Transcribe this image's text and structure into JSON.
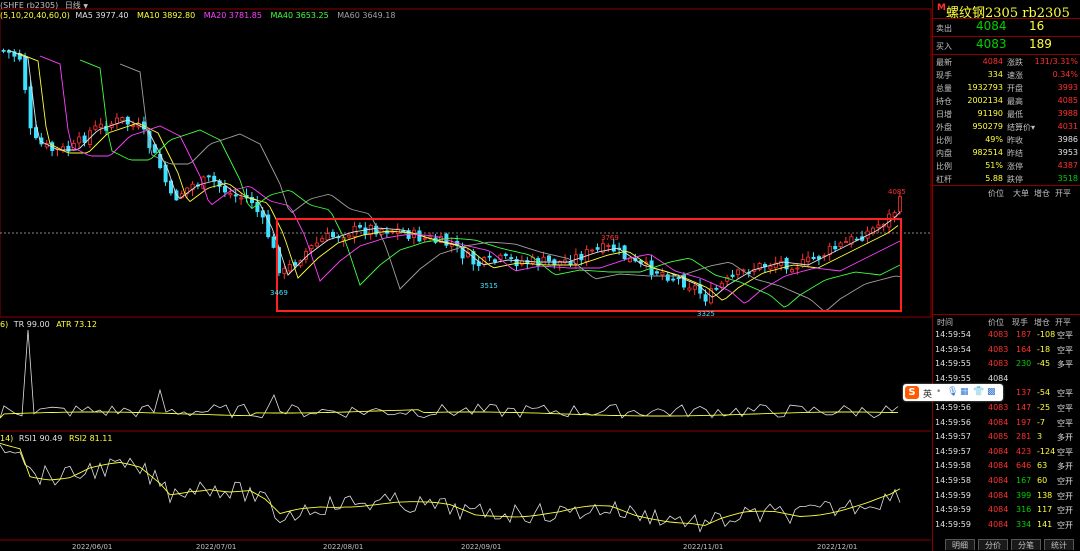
{
  "toolbar": {
    "symbol": "(SHFE rb2305)",
    "period": "日线"
  },
  "ma_legend": {
    "prefix": "(5,10,20,40,60,0)",
    "items": [
      {
        "label": "MA5 3977.40",
        "color": "#e0e0e0"
      },
      {
        "label": "MA10 3892.80",
        "color": "#ffff3a"
      },
      {
        "label": "MA20 3781.85",
        "color": "#ff40ff"
      },
      {
        "label": "MA40 3653.25",
        "color": "#40ff40"
      },
      {
        "label": "MA60 3649.18",
        "color": "#a0a0a0"
      }
    ]
  },
  "atr_legend": {
    "prefix": "6)",
    "tr": "TR 99.00",
    "atr": "ATR 73.12"
  },
  "rsi_legend": {
    "prefix": "14)",
    "rsi1": "RSI1 90.49",
    "rsi2": "RSI2 81.11"
  },
  "annotations": {
    "high_marker": "4085",
    "low_1": "3469",
    "low_2": "3515",
    "high_mid": "3769",
    "low_3": "3325"
  },
  "dates": [
    "2022/06/01",
    "2022/07/01",
    "2022/08/01",
    "2022/09/01",
    "2022/11/01",
    "2022/12/01"
  ],
  "chart_data": {
    "type": "candlestick",
    "title": "",
    "x_labels": [
      "2022/06/01",
      "2022/07/01",
      "2022/08/01",
      "2022/09/01",
      "2022/11/01",
      "2022/12/01"
    ],
    "price_labels": [
      {
        "label": "3469",
        "value": 3469
      },
      {
        "label": "3515",
        "value": 3515
      },
      {
        "label": "3769",
        "value": 3769
      },
      {
        "label": "3325",
        "value": 3325
      },
      {
        "label": "4085",
        "value": 4085
      }
    ],
    "last_close": 4084,
    "ma_values": {
      "MA5": 3977.4,
      "MA10": 3892.8,
      "MA20": 3781.85,
      "MA40": 3653.25,
      "MA60": 3649.18
    },
    "indicators": {
      "TR": 99.0,
      "ATR": 73.12,
      "RSI1": 90.49,
      "RSI2": 81.11
    }
  },
  "panel": {
    "m_mark": "M",
    "title": "螺纹钢2305  rb2305",
    "ask_label": "卖出",
    "ask_price": "4084",
    "ask_vol": "16",
    "bid_label": "买入",
    "bid_price": "4083",
    "bid_vol": "189",
    "stats": [
      {
        "l1": "最新",
        "v1": "4084",
        "c1": "red",
        "l2": "涨跌",
        "v2": "131/3.31%",
        "c2": "red"
      },
      {
        "l1": "现手",
        "v1": "334",
        "c1": "yel",
        "l2": "速涨",
        "v2": "0.34%",
        "c2": "red"
      },
      {
        "l1": "总量",
        "v1": "1932793",
        "c1": "yel",
        "l2": "开盘",
        "v2": "3993",
        "c2": "red"
      },
      {
        "l1": "持仓",
        "v1": "2002134",
        "c1": "yel",
        "l2": "最高",
        "v2": "4085",
        "c2": "red"
      },
      {
        "l1": "日增",
        "v1": "91190",
        "c1": "yel",
        "l2": "最低",
        "v2": "3988",
        "c2": "red"
      },
      {
        "l1": "外盘",
        "v1": "950279",
        "c1": "yel",
        "l2": "结算价▾",
        "v2": "4031",
        "c2": "red"
      },
      {
        "l1": "比例",
        "v1": "49%",
        "c1": "yel",
        "l2": "昨收",
        "v2": "3986",
        "c2": "wht"
      },
      {
        "l1": "内盘",
        "v1": "982514",
        "c1": "yel",
        "l2": "昨结",
        "v2": "3953",
        "c2": "wht"
      },
      {
        "l1": "比例",
        "v1": "51%",
        "c1": "yel",
        "l2": "涨停",
        "v2": "4387",
        "c2": "red"
      },
      {
        "l1": "杠杆",
        "v1": "5.88",
        "c1": "yel",
        "l2": "跌停",
        "v2": "3518",
        "c2": "grn"
      }
    ],
    "hdr1": [
      "价位",
      "大单",
      "增仓",
      "开平"
    ],
    "hdr2": [
      "时间",
      "价位",
      "现手",
      "增仓",
      "开平"
    ],
    "ticks": [
      {
        "time": "14:59:54",
        "price": "4083",
        "pc": "red",
        "vol": "187",
        "vc": "red",
        "oi": "-108",
        "oc": "yel",
        "type": "空平"
      },
      {
        "time": "14:59:54",
        "price": "4083",
        "pc": "red",
        "vol": "164",
        "vc": "red",
        "oi": "-18",
        "oc": "yel",
        "type": "空平"
      },
      {
        "time": "14:59:55",
        "price": "4083",
        "pc": "red",
        "vol": "230",
        "vc": "grn",
        "oi": "-45",
        "oc": "yel",
        "type": "多平"
      },
      {
        "time": "14:59:55",
        "price": "4084",
        "pc": "wht",
        "vol": "",
        "vc": "red",
        "oi": "",
        "oc": "yel",
        "type": ""
      },
      {
        "time": "",
        "price": "",
        "pc": "red",
        "vol": "137",
        "vc": "red",
        "oi": "-54",
        "oc": "yel",
        "type": "空平"
      },
      {
        "time": "14:59:56",
        "price": "4083",
        "pc": "red",
        "vol": "147",
        "vc": "red",
        "oi": "-25",
        "oc": "yel",
        "type": "空平"
      },
      {
        "time": "14:59:56",
        "price": "4084",
        "pc": "red",
        "vol": "197",
        "vc": "red",
        "oi": "-7",
        "oc": "yel",
        "type": "空平"
      },
      {
        "time": "14:59:57",
        "price": "4085",
        "pc": "red",
        "vol": "281",
        "vc": "red",
        "oi": "3",
        "oc": "yel",
        "type": "多开"
      },
      {
        "time": "14:59:57",
        "price": "4084",
        "pc": "red",
        "vol": "423",
        "vc": "red",
        "oi": "-124",
        "oc": "yel",
        "type": "空平"
      },
      {
        "time": "14:59:58",
        "price": "4084",
        "pc": "red",
        "vol": "646",
        "vc": "red",
        "oi": "63",
        "oc": "yel",
        "type": "多开"
      },
      {
        "time": "14:59:58",
        "price": "4084",
        "pc": "red",
        "vol": "167",
        "vc": "grn",
        "oi": "60",
        "oc": "yel",
        "type": "空开"
      },
      {
        "time": "14:59:59",
        "price": "4084",
        "pc": "red",
        "vol": "399",
        "vc": "grn",
        "oi": "138",
        "oc": "yel",
        "type": "空开"
      },
      {
        "time": "14:59:59",
        "price": "4084",
        "pc": "red",
        "vol": "316",
        "vc": "grn",
        "oi": "117",
        "oc": "yel",
        "type": "空开"
      },
      {
        "time": "14:59:59",
        "price": "4084",
        "pc": "red",
        "vol": "334",
        "vc": "grn",
        "oi": "141",
        "oc": "yel",
        "type": "空开"
      }
    ],
    "tabs": [
      "明细",
      "分价",
      "分笔",
      "统计"
    ]
  },
  "ime": {
    "logo": "S",
    "mode": "英"
  }
}
